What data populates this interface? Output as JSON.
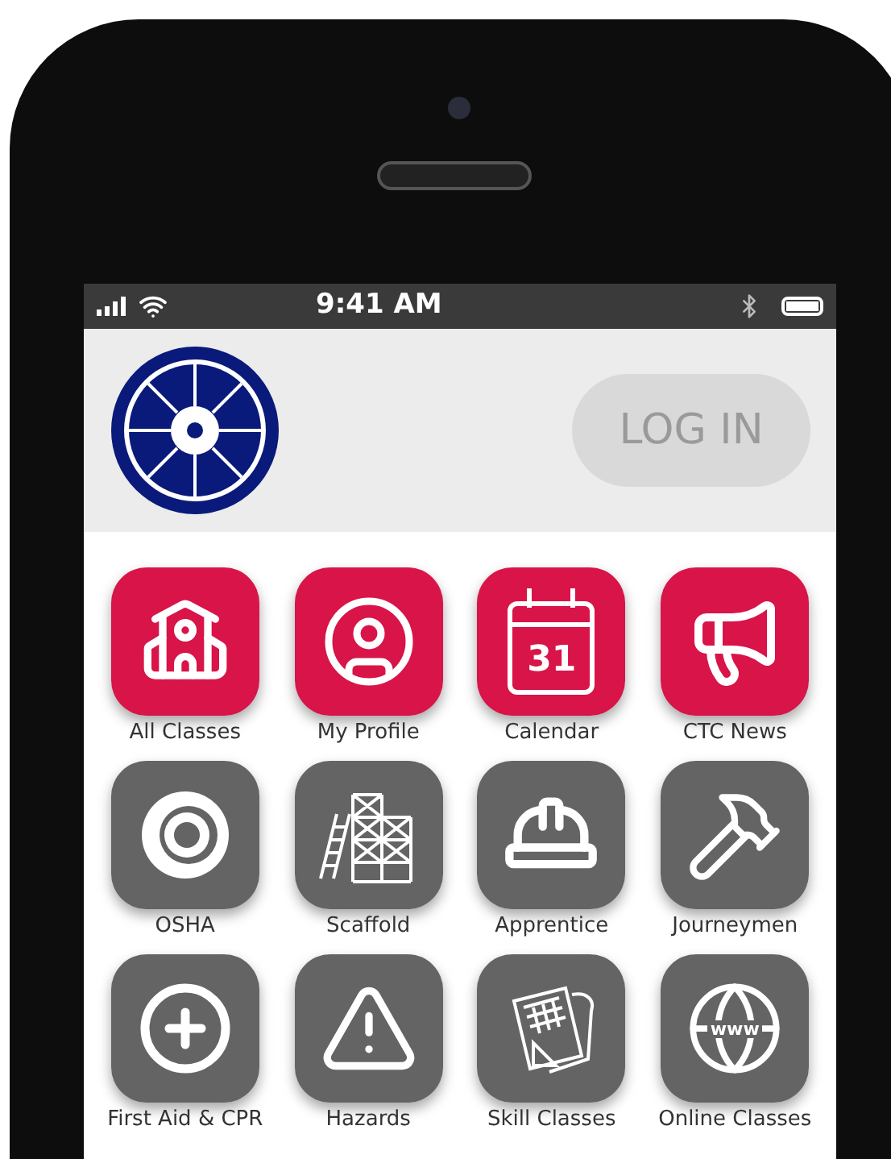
{
  "status_bar": {
    "time": "9:41 AM"
  },
  "header": {
    "login_button": "LOG IN"
  },
  "tiles": [
    {
      "label": "All Classes",
      "color": "#d81448"
    },
    {
      "label": "My Profile",
      "color": "#d81448"
    },
    {
      "label": "Calendar",
      "color": "#d81448",
      "icon_text": "31"
    },
    {
      "label": "CTC News",
      "color": "#d81448"
    },
    {
      "label": "OSHA",
      "color": "#646464"
    },
    {
      "label": "Scaffold",
      "color": "#646464"
    },
    {
      "label": "Apprentice",
      "color": "#646464"
    },
    {
      "label": "Journeymen",
      "color": "#646464"
    },
    {
      "label": "First Aid & CPR",
      "color": "#646464"
    },
    {
      "label": "Hazards",
      "color": "#646464"
    },
    {
      "label": "Skill Classes",
      "color": "#646464"
    },
    {
      "label": "Online Classes",
      "color": "#646464",
      "icon_text": "www"
    }
  ]
}
